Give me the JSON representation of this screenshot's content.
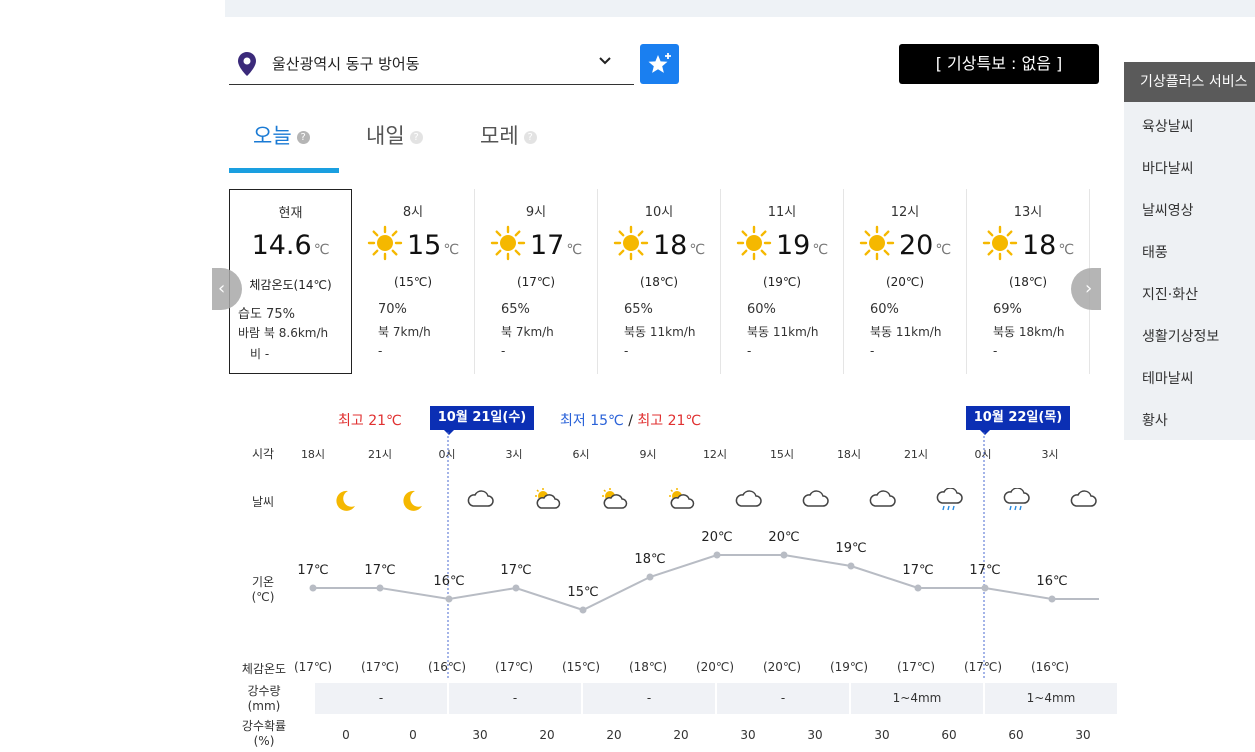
{
  "location": {
    "name": "울산광역시 동구 방어동"
  },
  "warning": "[ 기상특보 : 없음 ]",
  "tabs": [
    {
      "label": "오늘",
      "active": true
    },
    {
      "label": "내일",
      "active": false
    },
    {
      "label": "모레",
      "active": false
    }
  ],
  "current": {
    "hour": "현재",
    "temp": "14.6",
    "unit": "℃",
    "feel": "체감온도(14℃)",
    "humidity": "습도 75%",
    "wind": "바람 북 8.6km/h",
    "rain": "비 -"
  },
  "hourly": [
    {
      "hour": "8시",
      "temp": "15",
      "unit": "℃",
      "feel": "(15℃)",
      "humidity": "70%",
      "wind": "북 7km/h",
      "rain": "-"
    },
    {
      "hour": "9시",
      "temp": "17",
      "unit": "℃",
      "feel": "(17℃)",
      "humidity": "65%",
      "wind": "북 7km/h",
      "rain": "-"
    },
    {
      "hour": "10시",
      "temp": "18",
      "unit": "℃",
      "feel": "(18℃)",
      "humidity": "65%",
      "wind": "북동 11km/h",
      "rain": "-"
    },
    {
      "hour": "11시",
      "temp": "19",
      "unit": "℃",
      "feel": "(19℃)",
      "humidity": "60%",
      "wind": "북동 11km/h",
      "rain": "-"
    },
    {
      "hour": "12시",
      "temp": "20",
      "unit": "℃",
      "feel": "(20℃)",
      "humidity": "60%",
      "wind": "북동 11km/h",
      "rain": "-"
    },
    {
      "hour": "13시",
      "temp": "18",
      "unit": "℃",
      "feel": "(18℃)",
      "humidity": "69%",
      "wind": "북동 18km/h",
      "rain": "-"
    }
  ],
  "sidebar": {
    "title": "기상플러스 서비스",
    "items": [
      "육상날씨",
      "바다날씨",
      "날씨영상",
      "태풍",
      "지진·화산",
      "생활기상정보",
      "테마날씨",
      "황사"
    ]
  },
  "timeline": {
    "max_left": "최고 21℃",
    "date1": "10월 21일(수)",
    "min_label": "최저 15℃",
    "sep": "/",
    "max_label": "최고 21℃",
    "date2": "10월 22일(목)",
    "row_labels": {
      "time": "시각",
      "weather": "날씨",
      "temp": "기온\n(℃)",
      "feel": "체감온도",
      "precip": "강수량\n(mm)",
      "prob": "강수확률\n(%)"
    },
    "ticks": [
      "18시",
      "21시",
      "0시",
      "3시",
      "6시",
      "9시",
      "12시",
      "15시",
      "18시",
      "21시",
      "0시",
      "3시"
    ],
    "weather_icons": [
      "moon-icon",
      "moon-icon",
      "cloud-icon",
      "partly-cloudy-icon",
      "partly-cloudy-icon",
      "partly-cloudy-icon",
      "cloud-icon",
      "cloud-icon",
      "cloud-icon",
      "rain-cloud-icon",
      "rain-cloud-icon",
      "cloud-icon"
    ],
    "temps_text": [
      "17℃",
      "17℃",
      "16℃",
      "17℃",
      "15℃",
      "18℃",
      "20℃",
      "20℃",
      "19℃",
      "17℃",
      "17℃",
      "16℃"
    ],
    "feels": [
      "(17℃)",
      "(17℃)",
      "(16℃)",
      "(17℃)",
      "(15℃)",
      "(18℃)",
      "(20℃)",
      "(20℃)",
      "(19℃)",
      "(17℃)",
      "(17℃)",
      "(16℃)"
    ],
    "precip": [
      "-",
      "-",
      "-",
      "-",
      "1~4mm",
      "1~4mm"
    ],
    "prob": [
      "0",
      "0",
      "30",
      "20",
      "20",
      "20",
      "30",
      "30",
      "30",
      "60",
      "60",
      "30"
    ]
  },
  "chart_data": {
    "type": "line",
    "x": [
      "18시",
      "21시",
      "0시",
      "3시",
      "6시",
      "9시",
      "12시",
      "15시",
      "18시",
      "21시",
      "0시",
      "3시"
    ],
    "series": [
      {
        "values": [
          17,
          17,
          16,
          17,
          15,
          18,
          20,
          20,
          19,
          17,
          17,
          16
        ]
      }
    ],
    "ylabel": "기온\n(℃)"
  },
  "colors": {
    "accent": "#1a7ad4",
    "badge": "#0b2fb4",
    "max": "#e03030",
    "min": "#2a62d8"
  }
}
